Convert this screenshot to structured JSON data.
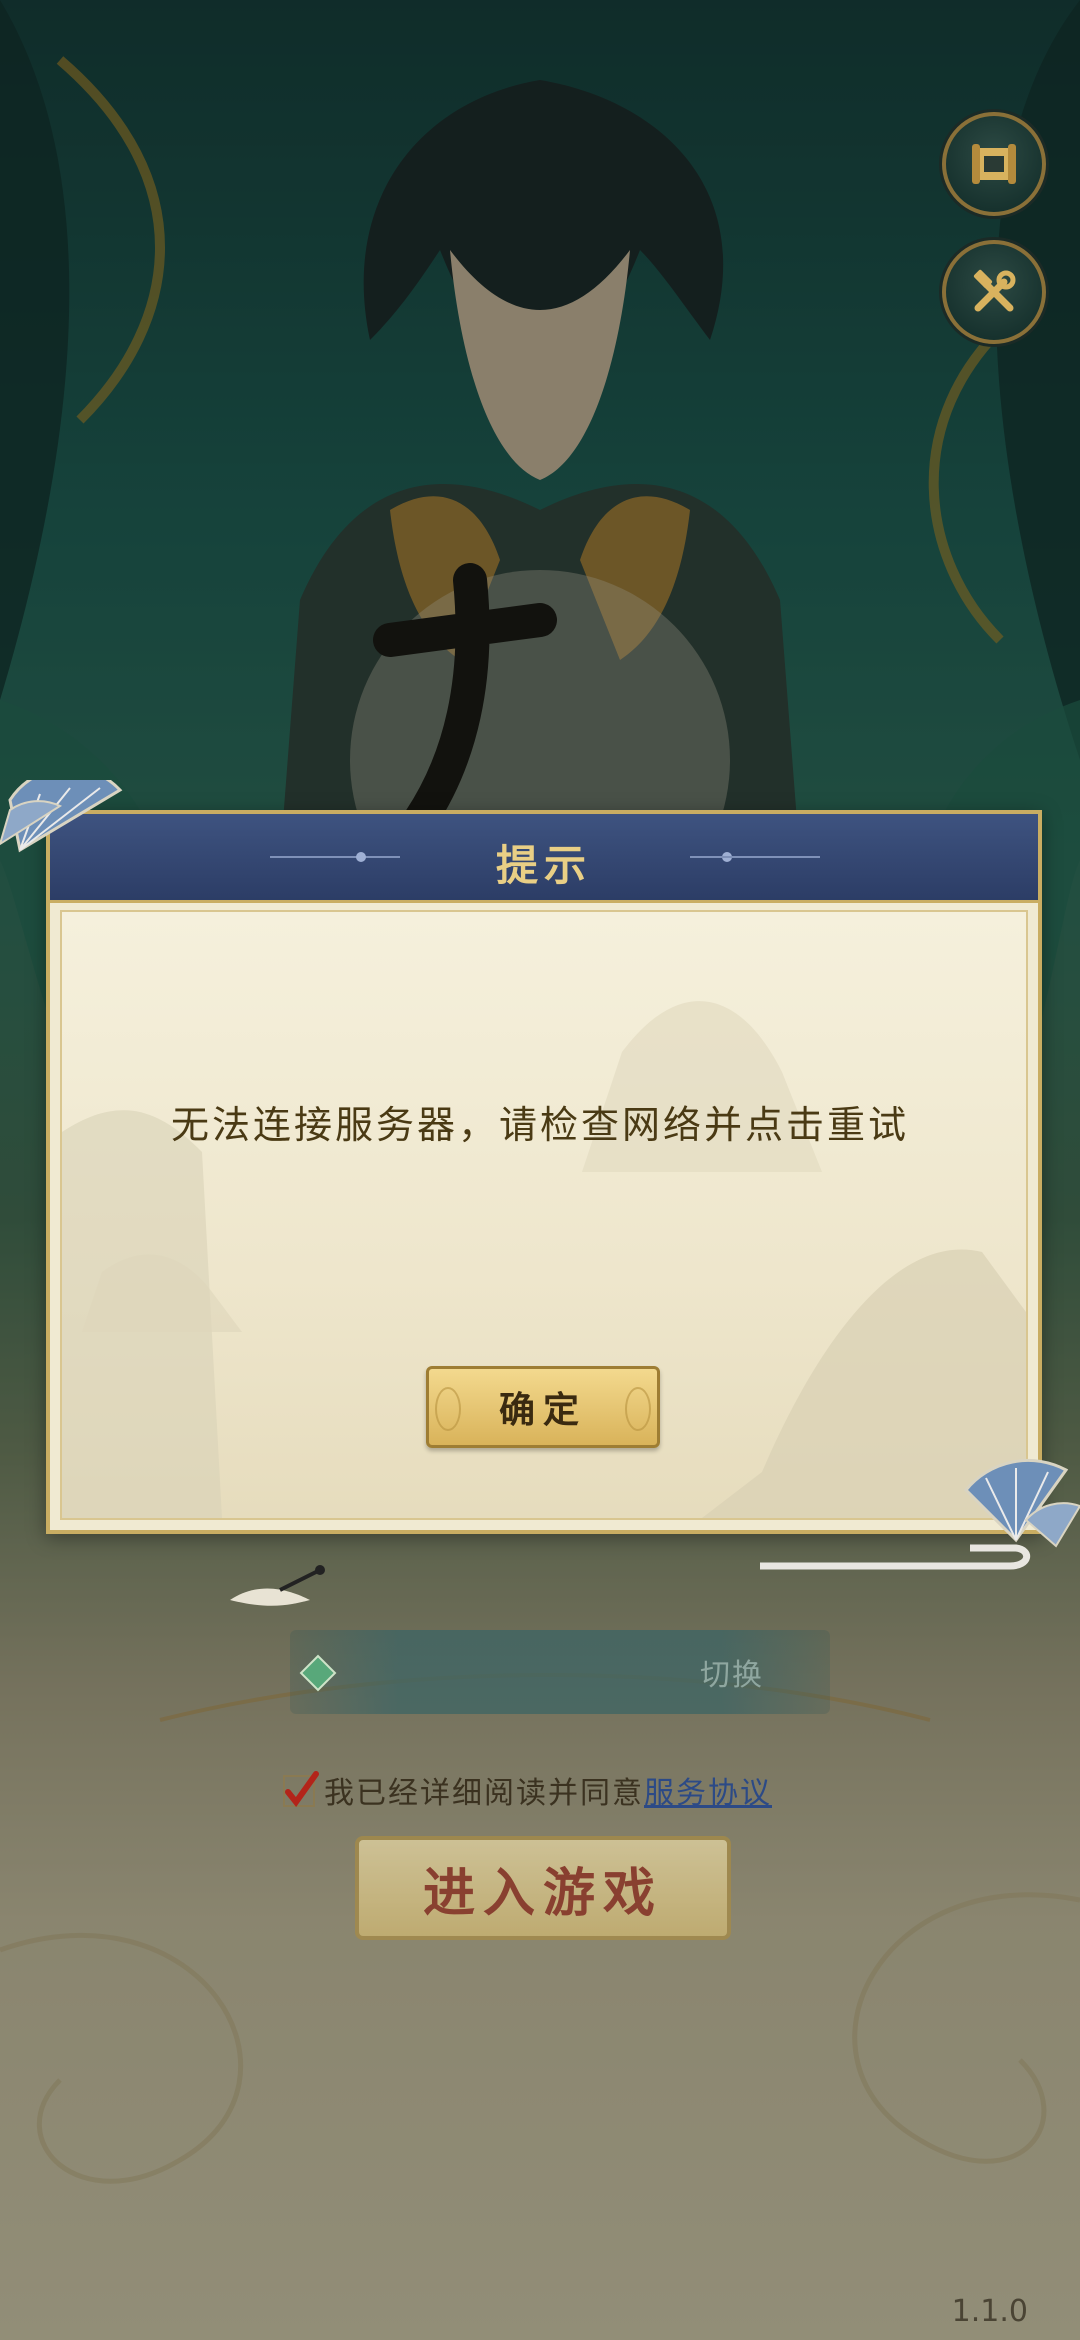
{
  "top_right_buttons": [
    {
      "icon": "scroll-icon"
    },
    {
      "icon": "tools-icon"
    }
  ],
  "dialog": {
    "title": "提示",
    "message": "无法连接服务器，请检查网络并点击重试",
    "confirm_label": "确定"
  },
  "server": {
    "switch_label": "切换"
  },
  "agreement": {
    "text": "我已经详细阅读并同意",
    "link_label": "服务协议",
    "checked": true
  },
  "enter_button_label": "进入游戏",
  "version": "1.1.0",
  "colors": {
    "dialog_header": "#2c3d66",
    "dialog_border": "#c9ad62",
    "dialog_body": "#f0ead2",
    "title_gold": "#e9cf85",
    "enter_text_red": "#8a2a1c",
    "link_blue": "#2c4a86"
  }
}
